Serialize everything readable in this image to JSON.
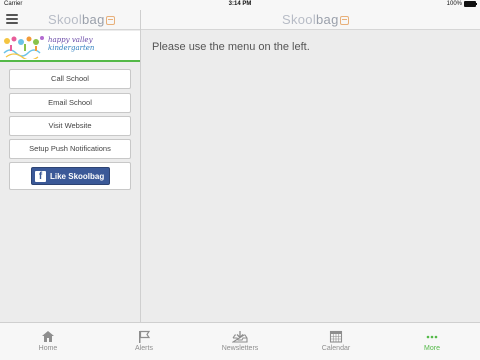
{
  "status_bar": {
    "carrier": "Carrier",
    "time": "3:14 PM",
    "battery": "100%",
    "battery_level": 1.0
  },
  "app": {
    "logo_part1": "Skool",
    "logo_part2": "bag"
  },
  "sidebar": {
    "banner_line1": "happy valley",
    "banner_line2": "kindergarten",
    "buttons": [
      {
        "label": "Call School"
      },
      {
        "label": "Email School"
      },
      {
        "label": "Visit Website"
      },
      {
        "label": "Setup Push Notifications"
      }
    ],
    "facebook_label": "Like Skoolbag"
  },
  "main": {
    "message": "Please use the menu on the left."
  },
  "tabbar": {
    "tabs": [
      {
        "label": "Home",
        "icon": "home-icon"
      },
      {
        "label": "Alerts",
        "icon": "flag-icon"
      },
      {
        "label": "Newsletters",
        "icon": "download-tray-icon"
      },
      {
        "label": "Calendar",
        "icon": "calendar-icon"
      },
      {
        "label": "More",
        "icon": "more-dots-icon"
      }
    ],
    "active_index": 4
  },
  "colors": {
    "accent": "#54b948",
    "facebook": "#3b5998",
    "tab_inactive": "#8e8e8e"
  }
}
